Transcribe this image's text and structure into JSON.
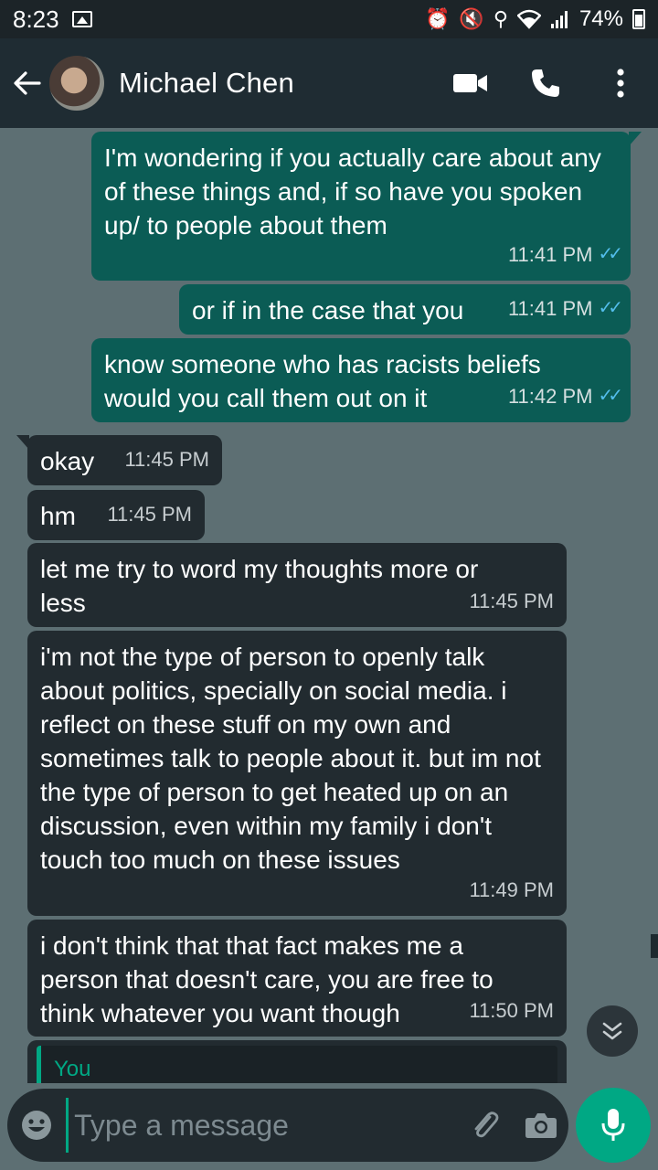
{
  "status_bar": {
    "time": "8:23",
    "battery": "74%"
  },
  "header": {
    "contact_name": "Michael Chen"
  },
  "messages": [
    {
      "direction": "out",
      "text": "I'm wondering if you actually care about any of these things and, if so have you spoken up/ to people about them",
      "time": "11:41 PM",
      "read": true
    },
    {
      "direction": "out",
      "text": "or if in the case that you",
      "time": "11:41 PM",
      "read": true
    },
    {
      "direction": "out",
      "text": "know someone who has racists beliefs would you call them out on it",
      "time": "11:42 PM",
      "read": true
    },
    {
      "direction": "in",
      "text": "okay",
      "time": "11:45 PM"
    },
    {
      "direction": "in",
      "text": "hm",
      "time": "11:45 PM"
    },
    {
      "direction": "in",
      "text": "let me try to word my thoughts more or less",
      "time": "11:45 PM"
    },
    {
      "direction": "in",
      "text": "i'm not the type of person to openly talk about politics, specially on social media. i reflect on these stuff on my own and sometimes talk to people about it. but im not the type of person to get heated up on an discussion, even within my family i don't touch too much on these issues",
      "time": "11:49 PM"
    },
    {
      "direction": "in",
      "text": "i don't think that that fact makes me a person that doesn't care, you are free to think whatever you want though",
      "time": "11:50 PM"
    }
  ],
  "quoted_reply": {
    "author": "You"
  },
  "composer": {
    "placeholder": "Type a message"
  },
  "colors": {
    "outgoing": "#0b5c55",
    "incoming": "#222b30",
    "accent": "#00a884",
    "read_ticks": "#53bdeb"
  }
}
